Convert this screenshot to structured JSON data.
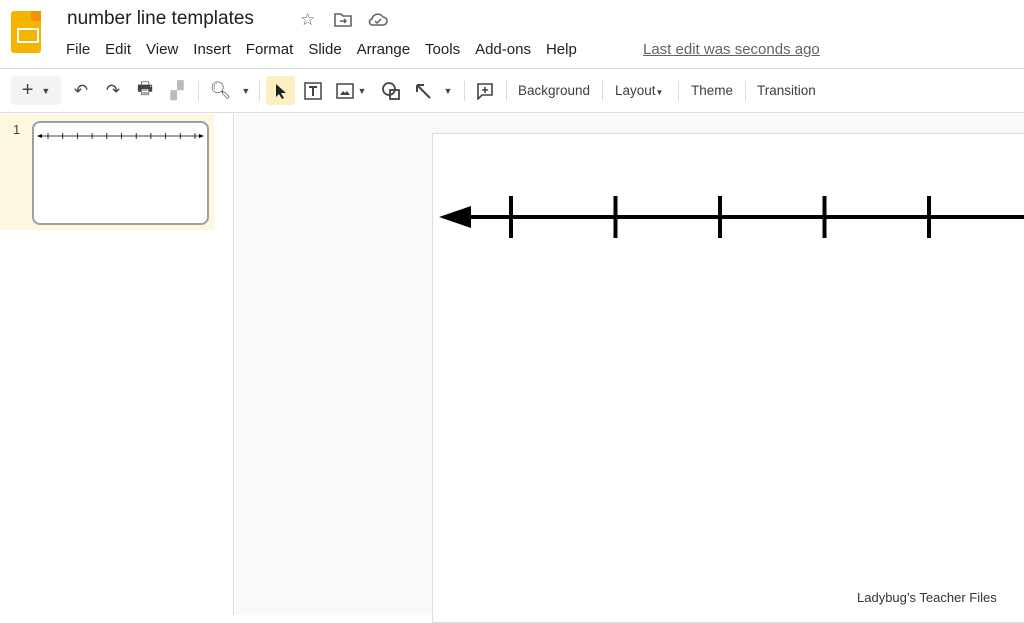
{
  "app": {
    "title": "number line templates",
    "last_edit": "Last edit was seconds ago",
    "logo_color": "#f4b400"
  },
  "header_icons": [
    "star-icon",
    "move-to-folder-icon",
    "cloud-saved-icon"
  ],
  "menu": [
    "File",
    "Edit",
    "View",
    "Insert",
    "Format",
    "Slide",
    "Arrange",
    "Tools",
    "Add-ons",
    "Help"
  ],
  "toolbar": {
    "background": "Background",
    "layout": "Layout",
    "theme": "Theme",
    "transition": "Transition",
    "active_tool": "select"
  },
  "slides": [
    {
      "number": "1",
      "selected": true,
      "thumbnail_ticks": 11
    }
  ],
  "slide": {
    "number_line_visible_ticks": 5,
    "arrow": "left"
  },
  "watermark": "Ladybug’s Teacher Files"
}
